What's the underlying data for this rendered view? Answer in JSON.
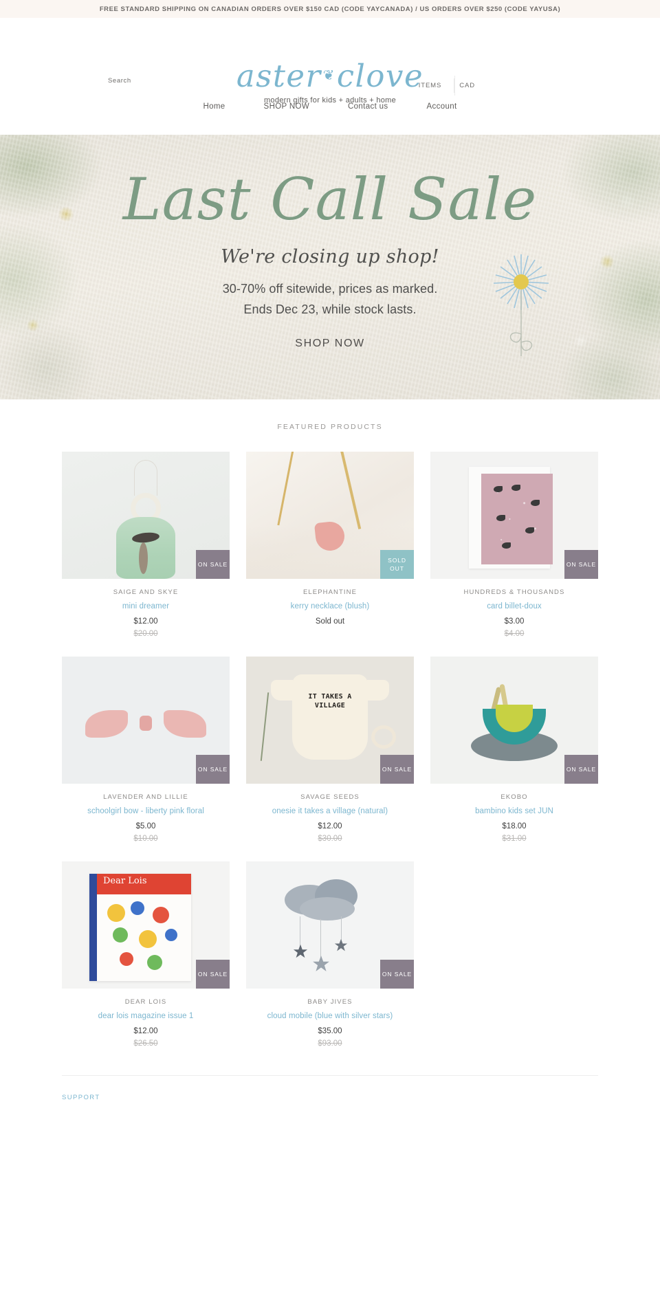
{
  "announcement": {
    "text": "FREE STANDARD SHIPPING ON CANADIAN ORDERS OVER $150 CAD (CODE YAYCANADA) / US ORDERS OVER $250 (CODE YAYUSA)"
  },
  "header": {
    "search_label": "Search",
    "logo_text_1": "aster",
    "logo_heart": "❦",
    "logo_text_2": "clove",
    "tagline": "modern gifts for kids + adults + home",
    "items_label": "ITEMS",
    "currency_label": "CAD"
  },
  "nav": {
    "items": [
      {
        "label": "Home"
      },
      {
        "label": "SHOP NOW"
      },
      {
        "label": "Contact us"
      },
      {
        "label": "Account"
      }
    ]
  },
  "hero": {
    "title": "Last Call Sale",
    "subtitle": "We're closing up shop!",
    "line1": "30-70% off sitewide, prices as marked.",
    "line2": "Ends Dec 23, while stock lasts.",
    "cta": "SHOP NOW"
  },
  "featured": {
    "title": "FEATURED PRODUCTS",
    "products": [
      {
        "vendor": "SAIGE AND SKYE",
        "title": "mini dreamer",
        "price": "$12.00",
        "compare_price": "$20.00",
        "badge": "ON SALE",
        "badge_type": "sale"
      },
      {
        "vendor": "ELEPHANTINE",
        "title": "kerry necklace (blush)",
        "price": "Sold out",
        "compare_price": "",
        "badge": "SOLD OUT",
        "badge_type": "sold"
      },
      {
        "vendor": "HUNDREDS & THOUSANDS",
        "title": "card billet-doux",
        "price": "$3.00",
        "compare_price": "$4.00",
        "badge": "ON SALE",
        "badge_type": "sale"
      },
      {
        "vendor": "LAVENDER AND LILLIE",
        "title": "schoolgirl bow - liberty pink floral",
        "price": "$5.00",
        "compare_price": "$10.00",
        "badge": "ON SALE",
        "badge_type": "sale"
      },
      {
        "vendor": "SAVAGE SEEDS",
        "title": "onesie it takes a village (natural)",
        "price": "$12.00",
        "compare_price": "$30.00",
        "badge": "ON SALE",
        "badge_type": "sale"
      },
      {
        "vendor": "EKOBO",
        "title": "bambino kids set JUN",
        "price": "$18.00",
        "compare_price": "$31.00",
        "badge": "ON SALE",
        "badge_type": "sale"
      },
      {
        "vendor": "DEAR LOIS",
        "title": "dear lois magazine issue 1",
        "price": "$12.00",
        "compare_price": "$26.50",
        "badge": "ON SALE",
        "badge_type": "sale"
      },
      {
        "vendor": "BABY JIVES",
        "title": "cloud mobile (blue with silver stars)",
        "price": "$35.00",
        "compare_price": "$93.00",
        "badge": "ON SALE",
        "badge_type": "sale"
      }
    ]
  },
  "footer": {
    "support_heading": "SUPPORT"
  },
  "colors": {
    "brand_blue": "#7cb6cf",
    "sage": "#7d9c84",
    "sale_badge": "#887e8b",
    "sold_badge": "#8fc2c6",
    "announce_bg": "#fbf6f2"
  },
  "product_art": {
    "onesie_text_line1": "IT TAKES A",
    "onesie_text_line2": "VILLAGE",
    "book_title": "Dear Lois"
  }
}
